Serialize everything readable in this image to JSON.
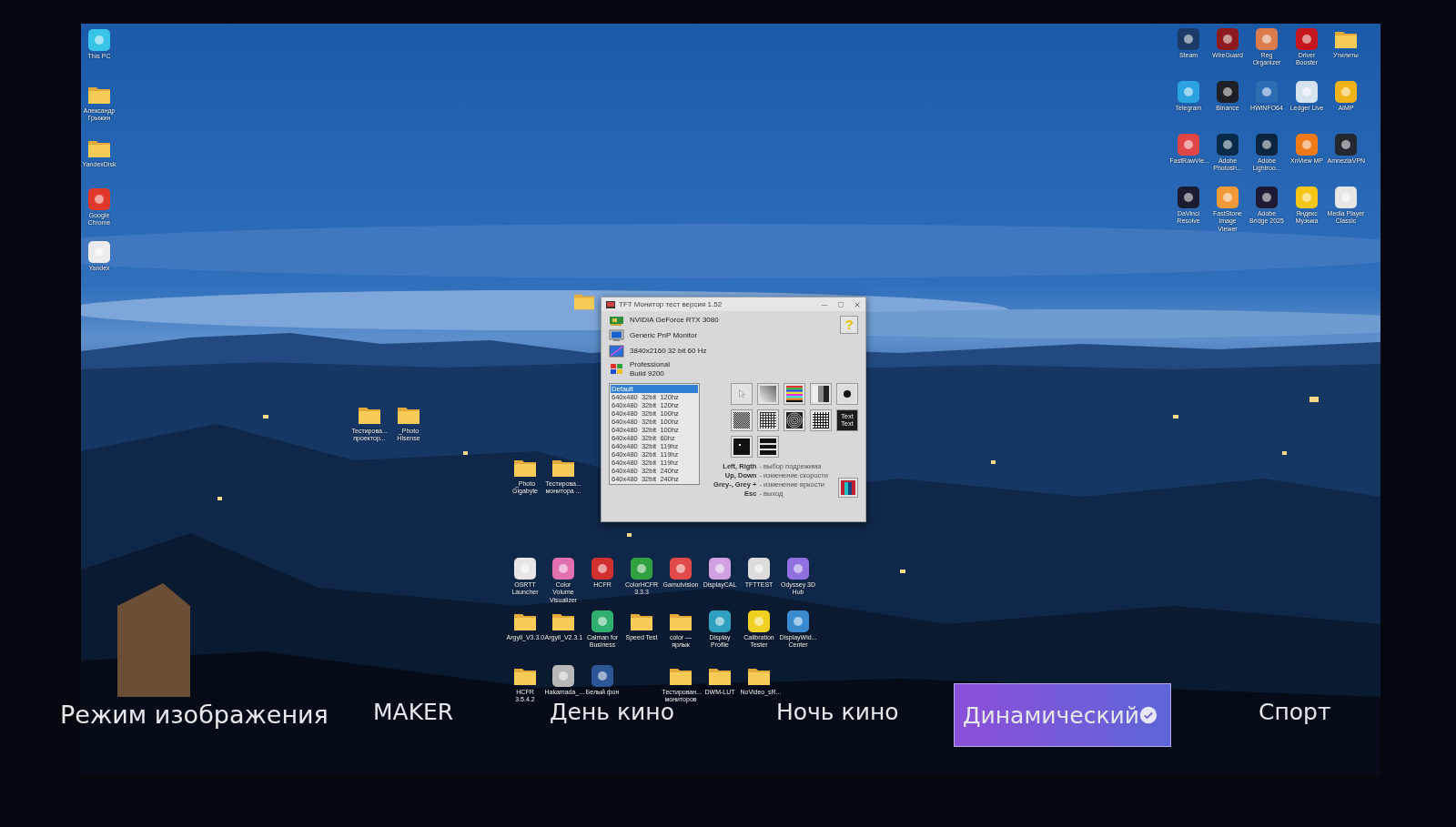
{
  "desktop": {
    "left_icons": [
      {
        "label": "This PC",
        "kind": "app",
        "color": "#38c4e6"
      },
      {
        "label": "Александр Грыжин",
        "kind": "folder"
      },
      {
        "label": "YandexDisk",
        "kind": "folder"
      },
      {
        "label": "Google Chrome",
        "kind": "app",
        "color": "#e0392c"
      },
      {
        "label": "Yandex",
        "kind": "app",
        "color": "#ececec"
      }
    ],
    "right_icons": [
      {
        "label": "Steam",
        "kind": "app",
        "color": "#1b3a66"
      },
      {
        "label": "WireGuard",
        "kind": "app",
        "color": "#8c1a1e"
      },
      {
        "label": "Reg Organizer",
        "kind": "app",
        "color": "#d97b4c"
      },
      {
        "label": "Driver Booster",
        "kind": "app",
        "color": "#c4161c"
      },
      {
        "label": "Утилиты",
        "kind": "folder"
      },
      {
        "label": "Telegram",
        "kind": "app",
        "color": "#2aa3e0"
      },
      {
        "label": "Binance",
        "kind": "app",
        "color": "#1e2026"
      },
      {
        "label": "HWiNFO64",
        "kind": "app",
        "color": "#2d6db4"
      },
      {
        "label": "Ledger Live",
        "kind": "app",
        "color": "#d6e2ee"
      },
      {
        "label": "AIMP",
        "kind": "app",
        "color": "#f2b318"
      },
      {
        "label": "FastRawVie...",
        "kind": "app",
        "color": "#e04646"
      },
      {
        "label": "Adobe Photosh...",
        "kind": "app",
        "color": "#0a2a4a"
      },
      {
        "label": "Adobe Lightroo...",
        "kind": "app",
        "color": "#0c2440"
      },
      {
        "label": "XnView MP",
        "kind": "app",
        "color": "#f07a1a"
      },
      {
        "label": "AmneziaVPN",
        "kind": "app",
        "color": "#23272e"
      },
      {
        "label": "DaVinci Resolve",
        "kind": "app",
        "color": "#1c1c30"
      },
      {
        "label": "FastStone Image Viewer",
        "kind": "app",
        "color": "#f29a3a"
      },
      {
        "label": "Adobe Bridge 2025",
        "kind": "app",
        "color": "#1e1a34"
      },
      {
        "label": "Яндекс Музыка",
        "kind": "app",
        "color": "#f5c518"
      },
      {
        "label": "Media Player Classic",
        "kind": "app",
        "color": "#e6e6e6"
      }
    ],
    "middle_icons": [
      {
        "label": "Тестирова... проектор...",
        "kind": "folder"
      },
      {
        "label": "_Photo Hisense",
        "kind": "folder"
      },
      {
        "label": "_Photo Gigabyte",
        "kind": "folder"
      },
      {
        "label": "Тестирова... монитора ...",
        "kind": "folder"
      }
    ],
    "bottom_icons": [
      {
        "label": "OSRTT Launcher",
        "kind": "app",
        "color": "#e6e6e6"
      },
      {
        "label": "Color Volume Visualizer",
        "kind": "app",
        "color": "#e070b0"
      },
      {
        "label": "HCFR",
        "kind": "app",
        "color": "#d03030"
      },
      {
        "label": "ColorHCFR 3.3.3",
        "kind": "app",
        "color": "#30a040"
      },
      {
        "label": "Gamutvision",
        "kind": "app",
        "color": "#e04a4a"
      },
      {
        "label": "DisplayCAL",
        "kind": "app",
        "color": "#d0a0e0"
      },
      {
        "label": "TFTTEST",
        "kind": "app",
        "color": "#dcdcdc"
      },
      {
        "label": "Odyssey 3D Hub",
        "kind": "app",
        "color": "#9070e0"
      },
      {
        "label": "Argyll_V3.3.0",
        "kind": "folder"
      },
      {
        "label": "Argyll_V2.3.1",
        "kind": "folder"
      },
      {
        "label": "Calman for Business",
        "kind": "app",
        "color": "#30b070"
      },
      {
        "label": "Speed Test",
        "kind": "folder"
      },
      {
        "label": "color — ярлык",
        "kind": "folder"
      },
      {
        "label": "Display Profile",
        "kind": "app",
        "color": "#30a0c0"
      },
      {
        "label": "Calibration Tester",
        "kind": "app",
        "color": "#f0d020"
      },
      {
        "label": "DisplayWid... Center",
        "kind": "app",
        "color": "#3a8ad0"
      },
      {
        "label": "HCFR 3.5.4.2",
        "kind": "folder"
      },
      {
        "label": "Hakamada_...",
        "kind": "app",
        "color": "#b8b8b8"
      },
      {
        "label": "Белый фон",
        "kind": "app",
        "color": "#2b5797"
      },
      {
        "label": "Тестирован... мониторов",
        "kind": "folder"
      },
      {
        "label": "DWM-LUT",
        "kind": "folder"
      },
      {
        "label": "NoVideo_sR...",
        "kind": "folder"
      }
    ]
  },
  "window": {
    "title": "TFT Монитор тест версия 1.52",
    "info": [
      {
        "kind": "gpu",
        "text": "NVIDIA GeForce RTX 3080"
      },
      {
        "kind": "monitor",
        "text": "Generic PnP Monitor"
      },
      {
        "kind": "resolution",
        "text": "3840x2160 32 bit 60 Hz"
      },
      {
        "kind": "os",
        "text": "Professional\nBuild 9200"
      }
    ],
    "help_button": "?",
    "modes": [
      {
        "text": "Default",
        "selected": true
      },
      {
        "text": "640x480  32bit  120hz",
        "selected": false
      },
      {
        "text": "640x480  32bit  120hz",
        "selected": false
      },
      {
        "text": "640x480  32bit  100hz",
        "selected": false
      },
      {
        "text": "640x480  32bit  100hz",
        "selected": false
      },
      {
        "text": "640x480  32bit  100hz",
        "selected": false
      },
      {
        "text": "640x480  32bit  60hz",
        "selected": false
      },
      {
        "text": "640x480  32bit  119hz",
        "selected": false
      },
      {
        "text": "640x480  32bit  119hz",
        "selected": false
      },
      {
        "text": "640x480  32bit  119hz",
        "selected": false
      },
      {
        "text": "640x480  32bit  240hz",
        "selected": false
      },
      {
        "text": "640x480  32bit  240hz",
        "selected": false
      }
    ],
    "tests": [
      {
        "kind": "blank"
      },
      {
        "kind": "gradient"
      },
      {
        "kind": "color-bars"
      },
      {
        "kind": "gray-bars"
      },
      {
        "kind": "dot"
      },
      {
        "kind": "checker"
      },
      {
        "kind": "grid"
      },
      {
        "kind": "rings"
      },
      {
        "kind": "dense-grid"
      },
      {
        "kind": "text",
        "label": "Text Text"
      },
      {
        "kind": "point"
      },
      {
        "kind": "lines"
      }
    ],
    "keys": [
      {
        "key": "Left, Rigth",
        "action": "- выбор подрежима"
      },
      {
        "key": "Up, Down",
        "action": "- изменение скорости"
      },
      {
        "key": "Grey-, Grey +",
        "action": "- изменение яркости"
      },
      {
        "key": "Esc",
        "action": "- выход"
      }
    ]
  },
  "osd": {
    "title": "Режим изображения",
    "options": [
      {
        "label": "MAKER",
        "selected": false
      },
      {
        "label": "День кино",
        "selected": false
      },
      {
        "label": "Ночь кино",
        "selected": false
      },
      {
        "label": "Динамический",
        "selected": true
      },
      {
        "label": "Спорт",
        "selected": false
      }
    ]
  }
}
